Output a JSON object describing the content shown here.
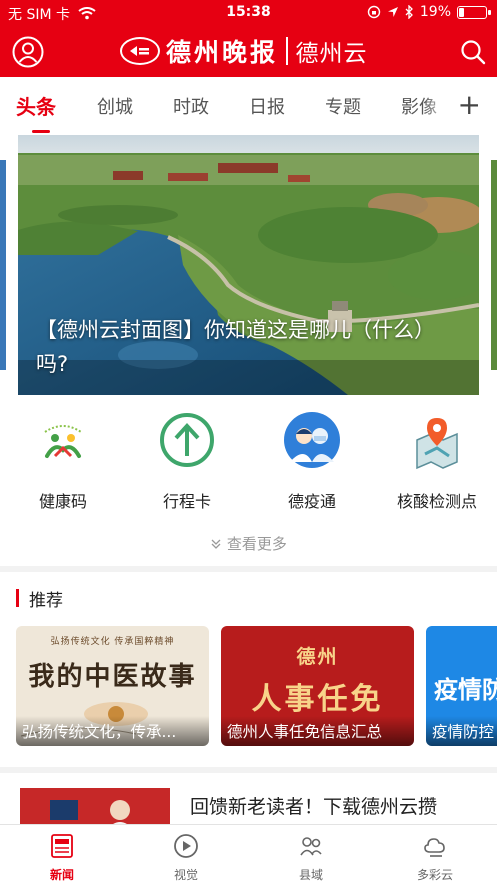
{
  "status_bar": {
    "carrier": "无 SIM 卡",
    "time": "15:38",
    "battery": "19%",
    "battery_level": 0.19,
    "icons": [
      "wifi-icon",
      "lock-rotation-icon",
      "location-icon",
      "bluetooth-icon",
      "battery-icon"
    ]
  },
  "header": {
    "brand_name": "德州晚报",
    "app_name": "德州云",
    "profile_icon": "user-icon",
    "search_icon": "search-icon",
    "color": "#e60012"
  },
  "tabs": {
    "items": [
      "头条",
      "创城",
      "时政",
      "日报",
      "专题",
      "影像"
    ],
    "active": "头条",
    "add_icon": "plus-icon"
  },
  "banner": {
    "caption": "【德州云封面图】你知道这是哪儿（什么）吗?"
  },
  "services": [
    {
      "label": "健康码",
      "icon": "health-code-icon"
    },
    {
      "label": "行程卡",
      "icon": "itinerary-arrow-icon"
    },
    {
      "label": "德疫通",
      "icon": "medical-staff-icon"
    },
    {
      "label": "核酸检测点",
      "icon": "map-pin-icon"
    }
  ],
  "more_label": "查看更多",
  "recommend": {
    "title": "推荐",
    "cards": [
      {
        "poster_top": "弘扬传统文化 传承国粹精神",
        "poster_title": "我的中医故事",
        "caption": "弘扬传统文化，传承..."
      },
      {
        "poster_top": "德州",
        "poster_title": "人事任免",
        "caption": "德州人事任免信息汇总"
      },
      {
        "poster_title": "疫情防",
        "caption": "疫情防控"
      }
    ]
  },
  "news_item": {
    "title": "回馈新老读者！下载德州云攒"
  },
  "bottom_nav": [
    {
      "label": "新闻",
      "icon": "newspaper-icon",
      "active": true
    },
    {
      "label": "视觉",
      "icon": "play-icon",
      "active": false
    },
    {
      "label": "县域",
      "icon": "people-icon",
      "active": false
    },
    {
      "label": "多彩云",
      "icon": "cloud-icon",
      "active": false
    }
  ]
}
